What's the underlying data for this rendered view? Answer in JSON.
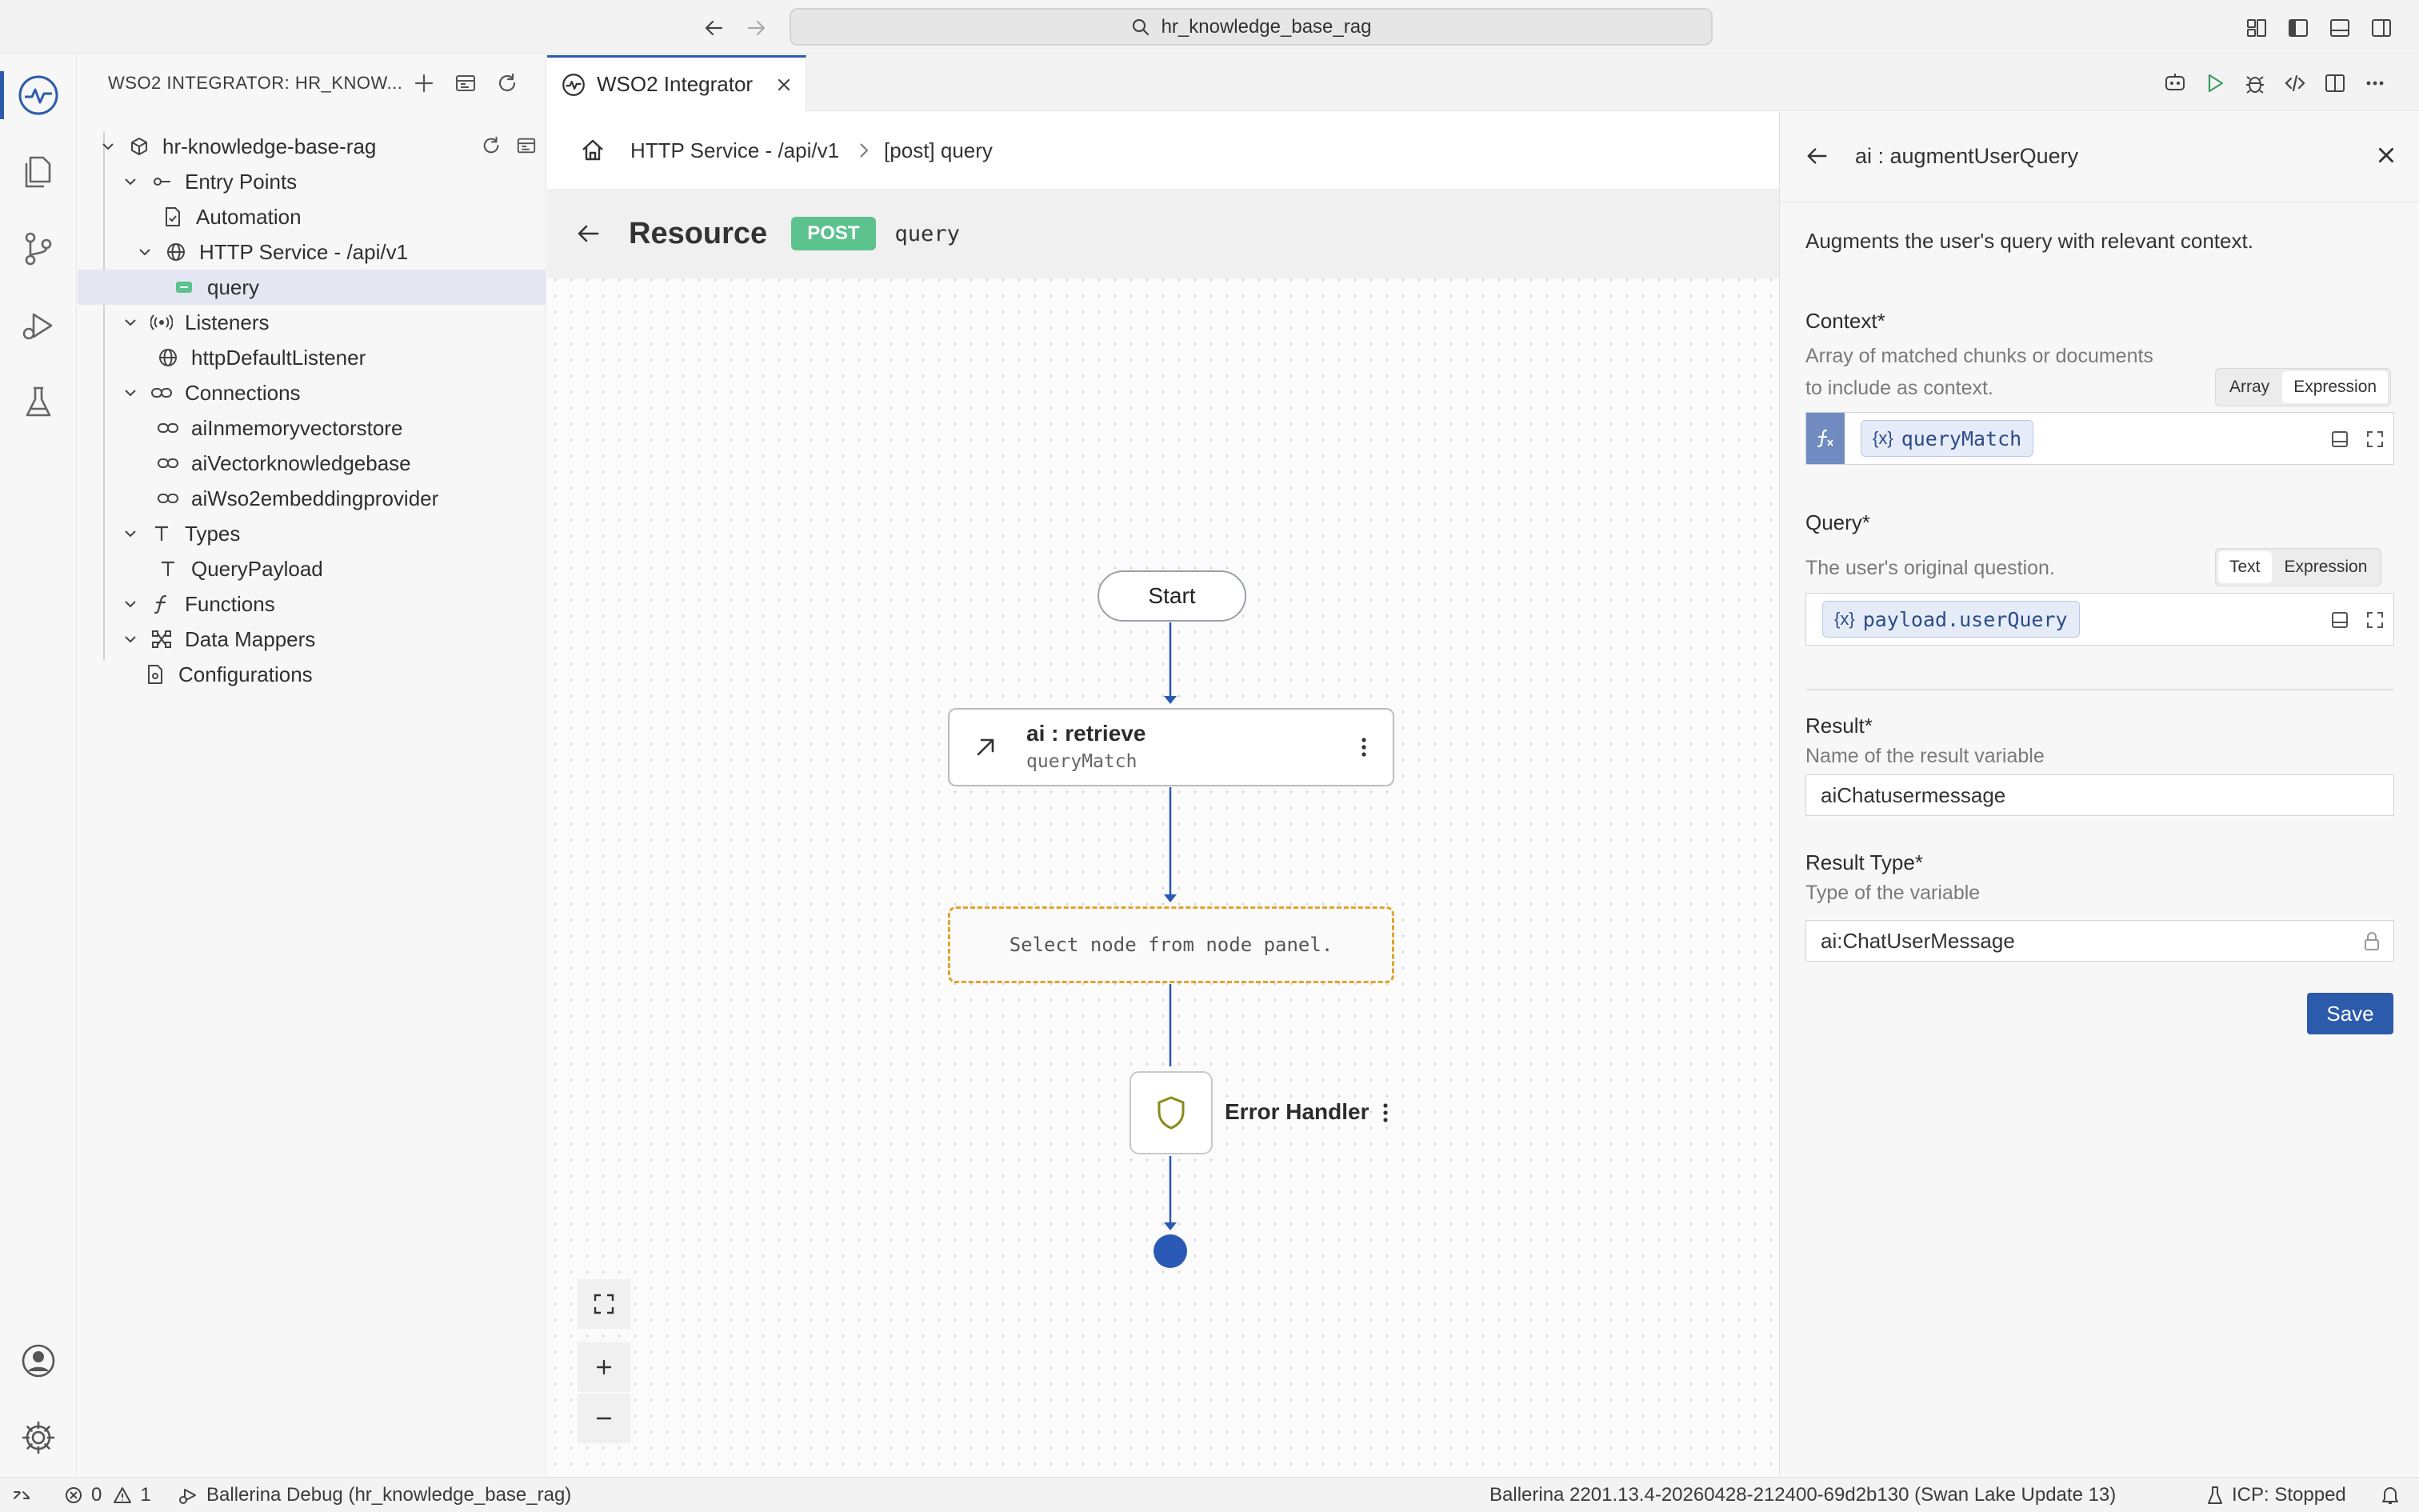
{
  "titlebar": {
    "search_text": "hr_knowledge_base_rag"
  },
  "sidebar": {
    "header_title": "WSO2 INTEGRATOR: HR_KNOW...",
    "project_name": "hr-knowledge-base-rag",
    "tree": {
      "entry_points": "Entry Points",
      "automation": "Automation",
      "http_service": "HTTP Service - /api/v1",
      "query": "query",
      "listeners": "Listeners",
      "http_listener": "httpDefaultListener",
      "connections": "Connections",
      "conn1": "aiInmemoryvectorstore",
      "conn2": "aiVectorknowledgebase",
      "conn3": "aiWso2embeddingprovider",
      "types": "Types",
      "query_payload": "QueryPayload",
      "functions": "Functions",
      "data_mappers": "Data Mappers",
      "configurations": "Configurations"
    }
  },
  "editor": {
    "tab_label": "WSO2 Integrator",
    "breadcrumb_service": "HTTP Service - /api/v1",
    "breadcrumb_resource": "[post] query",
    "resource_title": "Resource",
    "method": "POST",
    "path": "query"
  },
  "flow": {
    "start_label": "Start",
    "retrieve_title": "ai : retrieve",
    "retrieve_var": "queryMatch",
    "placeholder_text": "Select node from node panel.",
    "error_handler_label": "Error Handler"
  },
  "panel": {
    "title": "ai : augmentUserQuery",
    "description": "Augments the user's query with relevant context.",
    "context_label": "Context*",
    "context_desc_line1": "Array of matched chunks or documents",
    "context_desc_line2": "to include as context.",
    "context_mode_a": "Array",
    "context_mode_b": "Expression",
    "context_value": "queryMatch",
    "query_label": "Query*",
    "query_desc": "The user's original question.",
    "query_mode_a": "Text",
    "query_mode_b": "Expression",
    "query_value": "payload.userQuery",
    "var_badge": "{x}",
    "result_label": "Result*",
    "result_desc": "Name of the result variable",
    "result_value": "aiChatusermessage",
    "result_type_label": "Result Type*",
    "result_type_desc": "Type of the variable",
    "result_type_value": "ai:ChatUserMessage",
    "save_label": "Save"
  },
  "statusbar": {
    "errors": "0",
    "warnings": "1",
    "debug_label": "Ballerina Debug (hr_knowledge_base_rag)",
    "version": "Ballerina 2201.13.4-20260428-212400-69d2b130 (Swan Lake Update 13)",
    "icp_status": "ICP: Stopped"
  },
  "colors": {
    "accent": "#2c5bab",
    "post_badge": "#5cc28e",
    "placeholder_border": "#e0a42a",
    "save_button": "#2c5bab",
    "flow_line": "#2a59b5"
  }
}
